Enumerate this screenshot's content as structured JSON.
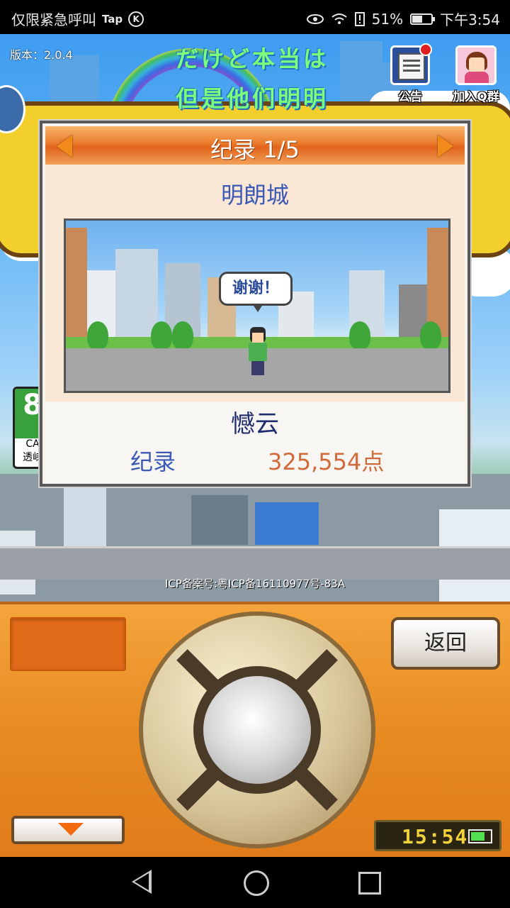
{
  "status_bar": {
    "carrier": "仅限紧急呼叫",
    "tap": "Tap",
    "k_badge": "K",
    "battery_text": "51%",
    "time": "下午3:54",
    "icons": [
      "eye-icon",
      "wifi-icon",
      "alert-icon",
      "battery-icon"
    ]
  },
  "scene": {
    "version": "版本：2.0.4",
    "title_jp": "だけど本当は",
    "title_cn": "但是他们明明",
    "notice_label": "公告",
    "qq_label": "加入Q群",
    "side_sign_label": "透峡",
    "side_sign_big": "8",
    "side_sign_small": "CA",
    "icp": "ICP备案号:粤ICP备16110977号-83A"
  },
  "dialog": {
    "title": "纪录 1/5",
    "city": "明朗城",
    "bubble": "谢谢！",
    "player": "憾云",
    "record_label": "纪录",
    "record_score": "325,554点"
  },
  "panel": {
    "back_label": "返回",
    "clock": "15:54",
    "accent": "#e88a22"
  }
}
